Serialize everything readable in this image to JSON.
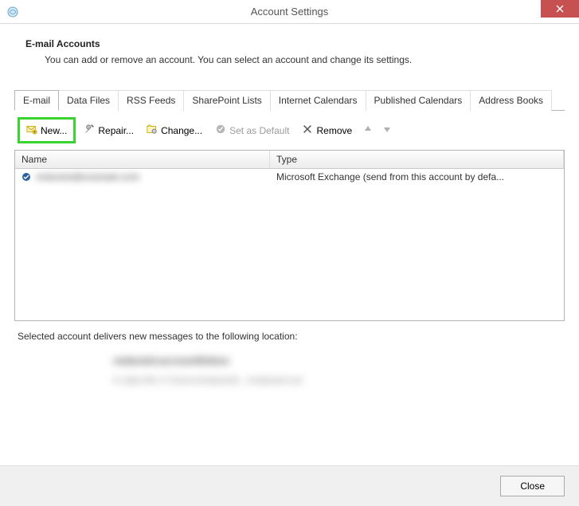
{
  "titlebar": {
    "title": "Account Settings"
  },
  "header": {
    "title": "E-mail Accounts",
    "description": "You can add or remove an account. You can select an account and change its settings."
  },
  "tabs": {
    "items": [
      {
        "label": "E-mail"
      },
      {
        "label": "Data Files"
      },
      {
        "label": "RSS Feeds"
      },
      {
        "label": "SharePoint Lists"
      },
      {
        "label": "Internet Calendars"
      },
      {
        "label": "Published Calendars"
      },
      {
        "label": "Address Books"
      }
    ]
  },
  "toolbar": {
    "new_label": "New...",
    "repair_label": "Repair...",
    "change_label": "Change...",
    "setdefault_label": "Set as Default",
    "remove_label": "Remove"
  },
  "list": {
    "col_name": "Name",
    "col_type": "Type",
    "rows": [
      {
        "name": "redacted@example.com",
        "type": "Microsoft Exchange (send from this account by defa..."
      }
    ]
  },
  "below": {
    "text": "Selected account delivers new messages to the following location:",
    "line1": "redacted.account\\Inbox",
    "line2": "in data file C:\\Users\\redacted\\...\\redacted.ost"
  },
  "footer": {
    "close_label": "Close"
  }
}
